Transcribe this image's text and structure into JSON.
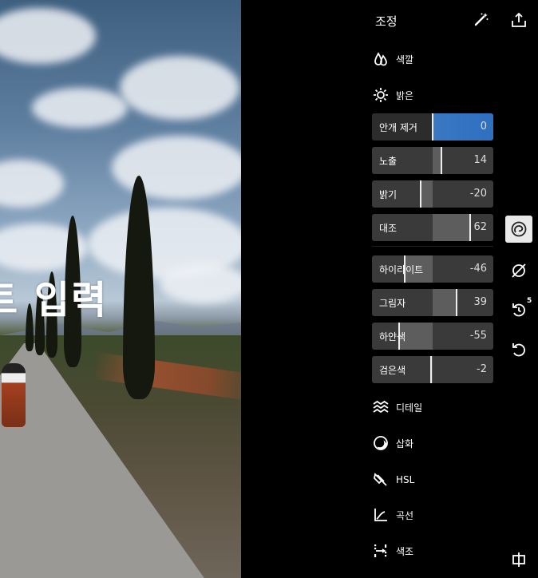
{
  "overlay_text": "트 입력",
  "panel": {
    "title": "조정",
    "sections_top": [
      {
        "label": "색깔",
        "icon": "color-drops-icon"
      },
      {
        "label": "밝은",
        "icon": "sun-icon"
      }
    ],
    "sliders": [
      {
        "label": "안개 제거",
        "value": "0",
        "level": 0,
        "active": true
      },
      {
        "label": "노출",
        "value": "14",
        "level": 14
      },
      {
        "label": "밝기",
        "value": "-20",
        "level": -20
      },
      {
        "label": "대조",
        "value": "62",
        "level": 62
      },
      {
        "label": "하이라이트",
        "value": "-46",
        "level": -46
      },
      {
        "label": "그림자",
        "value": "39",
        "level": 39
      },
      {
        "label": "하얀색",
        "value": "-55",
        "level": -55
      },
      {
        "label": "검은색",
        "value": "-2",
        "level": -2
      }
    ],
    "sections_bottom": [
      {
        "label": "디테일",
        "icon": "detail-waves-icon"
      },
      {
        "label": "삽화",
        "icon": "vignette-icon"
      },
      {
        "label": "HSL",
        "icon": "hsl-icon"
      },
      {
        "label": "곡선",
        "icon": "curves-icon"
      },
      {
        "label": "색조",
        "icon": "split-tone-icon"
      }
    ]
  },
  "rail": {
    "history_count": "5",
    "icons": [
      "share-icon",
      "adjust-icon",
      "hide-icon",
      "undo-history-icon",
      "undo-icon",
      "compare-icon"
    ]
  },
  "colors": {
    "accent": "#3a78c3",
    "background": "#000000"
  }
}
